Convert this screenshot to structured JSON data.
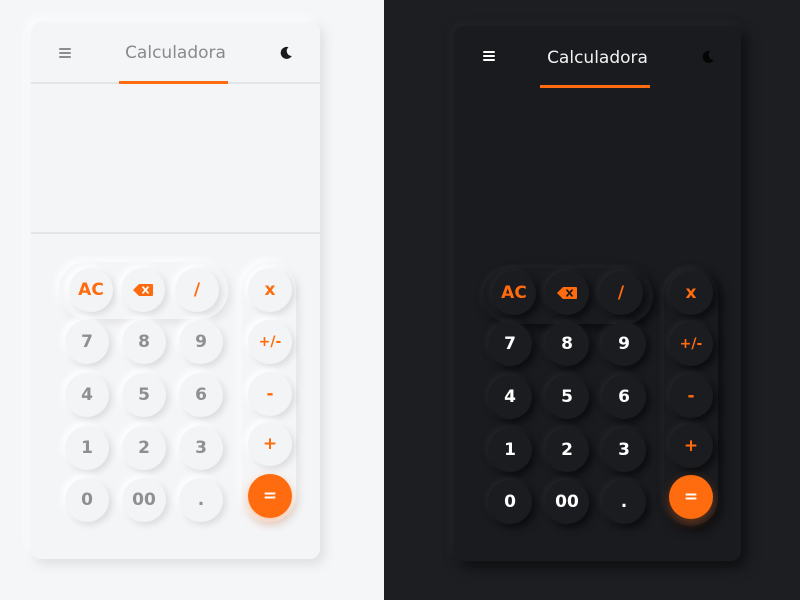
{
  "title": "Calculadora",
  "icons": {
    "menu": "hamburger-menu-icon",
    "theme": "moon-icon",
    "backspace": "backspace-icon"
  },
  "colors": {
    "accent": "#ff6b0f",
    "light_bg": "#f4f5f7",
    "dark_bg": "#1a1b1f"
  },
  "keys": {
    "clear": "AC",
    "divide": "/",
    "multiply": "x",
    "sign": "+/-",
    "minus": "-",
    "plus": "+",
    "equals": "=",
    "seven": "7",
    "eight": "8",
    "nine": "9",
    "four": "4",
    "five": "5",
    "six": "6",
    "one": "1",
    "two": "2",
    "three": "3",
    "zero": "0",
    "double_zero": "00",
    "decimal": "."
  },
  "light_theme": {
    "display_value": ""
  },
  "dark_theme": {
    "display_value": ""
  }
}
